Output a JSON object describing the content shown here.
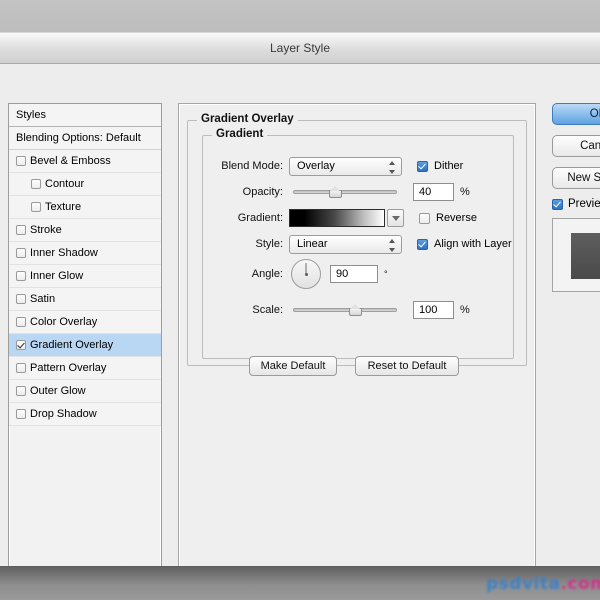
{
  "window": {
    "title": "Layer Style"
  },
  "styles_list": {
    "header": "Styles",
    "blending_options": "Blending Options: Default",
    "items": [
      {
        "label": "Bevel & Emboss",
        "checked": false,
        "indent": false,
        "selected": false
      },
      {
        "label": "Contour",
        "checked": false,
        "indent": true,
        "selected": false
      },
      {
        "label": "Texture",
        "checked": false,
        "indent": true,
        "selected": false
      },
      {
        "label": "Stroke",
        "checked": false,
        "indent": false,
        "selected": false
      },
      {
        "label": "Inner Shadow",
        "checked": false,
        "indent": false,
        "selected": false
      },
      {
        "label": "Inner Glow",
        "checked": false,
        "indent": false,
        "selected": false
      },
      {
        "label": "Satin",
        "checked": false,
        "indent": false,
        "selected": false
      },
      {
        "label": "Color Overlay",
        "checked": false,
        "indent": false,
        "selected": false
      },
      {
        "label": "Gradient Overlay",
        "checked": true,
        "indent": false,
        "selected": true
      },
      {
        "label": "Pattern Overlay",
        "checked": false,
        "indent": false,
        "selected": false
      },
      {
        "label": "Outer Glow",
        "checked": false,
        "indent": false,
        "selected": false
      },
      {
        "label": "Drop Shadow",
        "checked": false,
        "indent": false,
        "selected": false
      }
    ]
  },
  "main_panel": {
    "section_title": "Gradient Overlay",
    "group_title": "Gradient",
    "blend_mode": {
      "label": "Blend Mode:",
      "value": "Overlay"
    },
    "dither": {
      "label": "Dither",
      "checked": true
    },
    "opacity": {
      "label": "Opacity:",
      "value": "40",
      "unit": "%",
      "percent": 40
    },
    "gradient": {
      "label": "Gradient:",
      "from": "#000000",
      "to": "#ffffff"
    },
    "reverse": {
      "label": "Reverse",
      "checked": false
    },
    "style": {
      "label": "Style:",
      "value": "Linear"
    },
    "align_with_layer": {
      "label": "Align with Layer",
      "checked": true
    },
    "angle": {
      "label": "Angle:",
      "value": "90",
      "unit": "°",
      "degrees": 90
    },
    "scale": {
      "label": "Scale:",
      "value": "100",
      "unit": "%",
      "percent": 60
    },
    "make_default": "Make Default",
    "reset_to_default": "Reset to Default"
  },
  "right_column": {
    "ok": "OK",
    "cancel": "Cancel",
    "new_style": "New Style...",
    "preview": {
      "label": "Preview",
      "checked": true
    }
  },
  "watermark": {
    "part_a": "psdvita",
    "part_b": ".com"
  },
  "colors": {
    "accent": "#2f72c4",
    "selection": "#b9d6f2",
    "dialog_bg": "#efefef"
  }
}
